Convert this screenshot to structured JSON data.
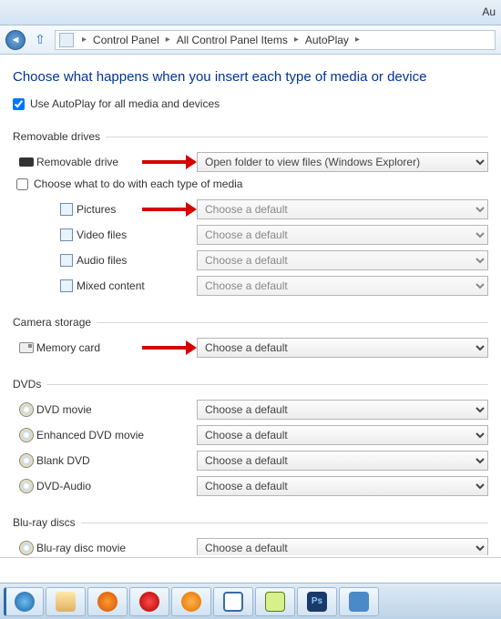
{
  "titlebar": {
    "partial": "Au"
  },
  "breadcrumb": {
    "items": [
      "Control Panel",
      "All Control Panel Items",
      "AutoPlay"
    ]
  },
  "heading": "Choose what happens when you insert each type of media or device",
  "use_all": {
    "label": "Use AutoPlay for all media and devices",
    "checked": true
  },
  "sections": {
    "removable": {
      "legend": "Removable drives",
      "drive_label": "Removable drive",
      "drive_value": "Open folder to view files (Windows Explorer)",
      "choose_types": {
        "label": "Choose what to do with each type of media",
        "checked": false
      },
      "types": [
        {
          "label": "Pictures",
          "value": "Choose a default"
        },
        {
          "label": "Video files",
          "value": "Choose a default"
        },
        {
          "label": "Audio files",
          "value": "Choose a default"
        },
        {
          "label": "Mixed content",
          "value": "Choose a default"
        }
      ]
    },
    "camera": {
      "legend": "Camera storage",
      "label": "Memory card",
      "value": "Choose a default"
    },
    "dvds": {
      "legend": "DVDs",
      "items": [
        {
          "label": "DVD movie",
          "value": "Choose a default"
        },
        {
          "label": "Enhanced DVD movie",
          "value": "Choose a default"
        },
        {
          "label": "Blank DVD",
          "value": "Choose a default"
        },
        {
          "label": "DVD-Audio",
          "value": "Choose a default"
        }
      ]
    },
    "bluray": {
      "legend": "Blu-ray discs",
      "items": [
        {
          "label": "Blu-ray disc movie",
          "value": "Choose a default"
        }
      ]
    }
  },
  "taskbar": {
    "items": [
      "internet-explorer",
      "file-explorer",
      "firefox",
      "opera",
      "windows-media-player",
      "word",
      "dreamweaver",
      "photoshop",
      "control-panel"
    ]
  }
}
